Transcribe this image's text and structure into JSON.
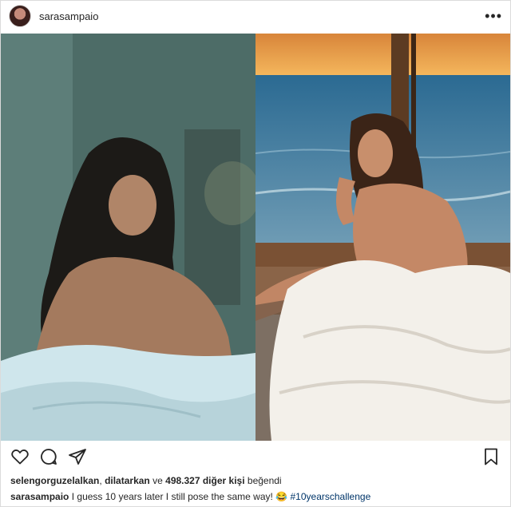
{
  "post": {
    "username": "sarasampaio",
    "more_label": "•••"
  },
  "likes": {
    "user1": "selengorguzelalkan",
    "separator": ",",
    "user2": "dilatarkan",
    "conj": "ve",
    "count": "498.327 diğer kişi",
    "suffix": "beğendi"
  },
  "caption": {
    "username": "sarasampaio",
    "text": "I guess 10 years later I still pose the same way!",
    "emoji": "😂",
    "hashtag": "#10yearschallenge"
  },
  "icons": {
    "like": "heart-icon",
    "comment": "comment-icon",
    "share": "share-icon",
    "save": "bookmark-icon"
  },
  "colors": {
    "text": "#262626",
    "hashtag": "#003569",
    "border": "#dbdbdb"
  }
}
